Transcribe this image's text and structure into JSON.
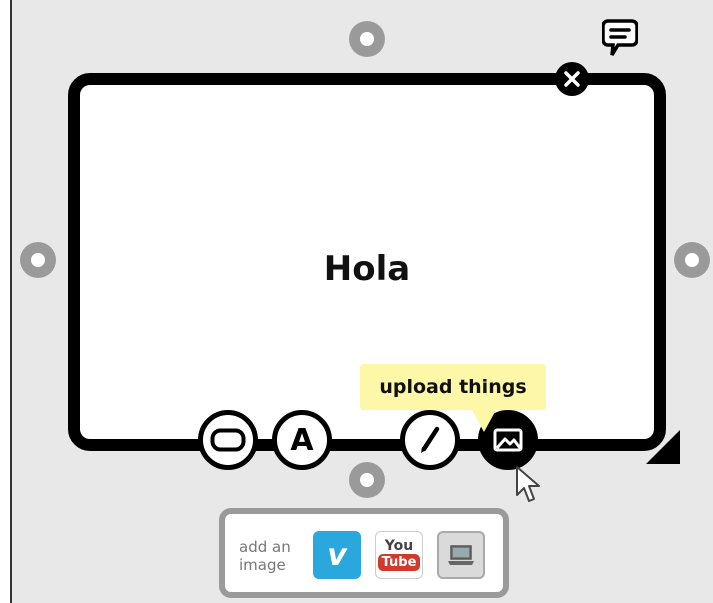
{
  "card": {
    "text": "Hola"
  },
  "tooltip": {
    "text": "upload things"
  },
  "media_panel": {
    "label_line1": "add an",
    "label_line2": "image",
    "vimeo_glyph": "v",
    "youtube_top": "You",
    "youtube_bottom": "Tube"
  },
  "tools": [
    {
      "icon": "shape-icon"
    },
    {
      "icon": "text-icon",
      "glyph": "A"
    },
    {
      "icon": "pen-icon"
    },
    {
      "icon": "image-icon"
    }
  ],
  "colors": {
    "workspace": "#e8e8e8",
    "card_border": "#000000",
    "tooltip_bg": "#fdf7a8",
    "handle": "#9a9a9a",
    "vimeo": "#2aa7dd",
    "youtube_red": "#d23a2c"
  }
}
